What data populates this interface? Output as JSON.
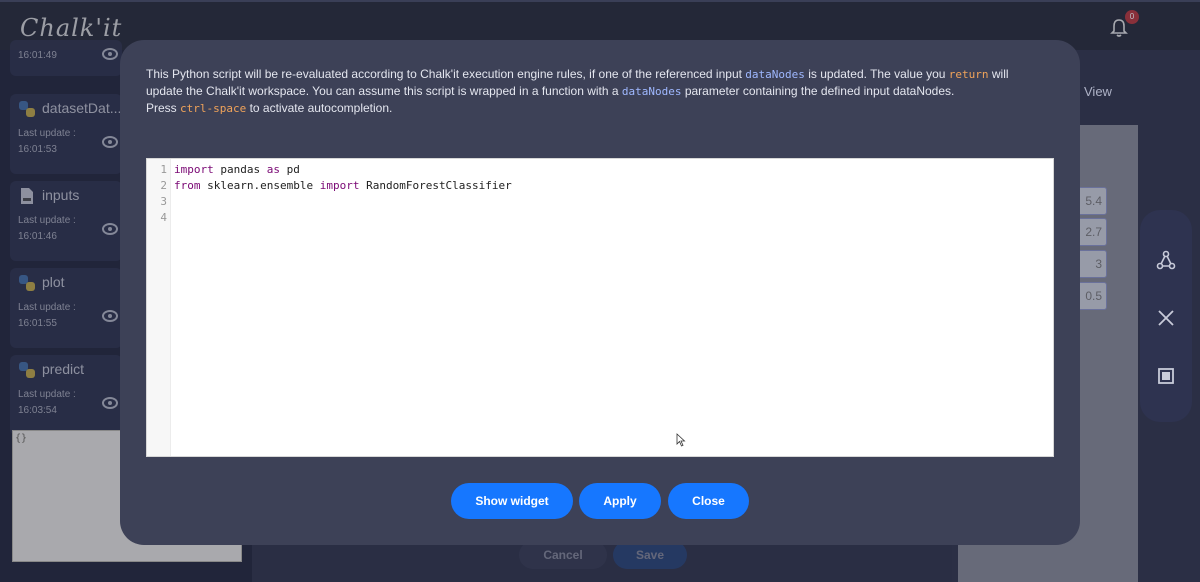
{
  "app": {
    "logo_text": "Chalk'it",
    "notification_count": "0"
  },
  "sidebar": {
    "datanodes": [
      {
        "name": "",
        "last_update_label": "",
        "time": "16:01:49"
      },
      {
        "name": "datasetDat...",
        "last_update_label": "Last update :",
        "time": "16:01:53"
      },
      {
        "name": "inputs",
        "last_update_label": "Last update :",
        "time": "16:01:46"
      },
      {
        "name": "plot",
        "last_update_label": "Last update :",
        "time": "16:01:55"
      },
      {
        "name": "predict",
        "last_update_label": "Last update :",
        "time": "16:03:54"
      }
    ],
    "preview_text": "{}"
  },
  "workspace": {
    "view_label": "View",
    "cells": [
      "5.4",
      "2.7",
      "3",
      "0.5"
    ],
    "cancel_label": "Cancel",
    "save_label": "Save"
  },
  "modal": {
    "description": {
      "p1": "This Python script will be re-evaluated according to Chalk'it execution engine rules, if one of the referenced input ",
      "code1": "dataNodes",
      "p2": " is updated. The value you ",
      "code2": "return",
      "p3": " will update the Chalk'it workspace. You can assume this script is wrapped in a function with a ",
      "code3": "dataNodes",
      "p4": " parameter containing the defined input dataNodes.",
      "p5": "Press ",
      "code4": "ctrl-space",
      "p6": " to activate autocompletion."
    },
    "editor": {
      "line_numbers": [
        "1",
        "2",
        "3",
        "4"
      ],
      "line1": {
        "kw1": "import",
        "t1": " pandas ",
        "kw2": "as",
        "t2": " pd"
      },
      "line2": {
        "kw1": "from",
        "t1": " sklearn.ensemble ",
        "kw2": "import",
        "t2": " RandomForestClassifier"
      },
      "line3": "",
      "line4": ""
    },
    "buttons": {
      "show_widget": "Show widget",
      "apply": "Apply",
      "close": "Close"
    }
  },
  "colors": {
    "accent": "#1677ff",
    "modal_bg": "#3d4157",
    "keyword": "#7a0874"
  }
}
